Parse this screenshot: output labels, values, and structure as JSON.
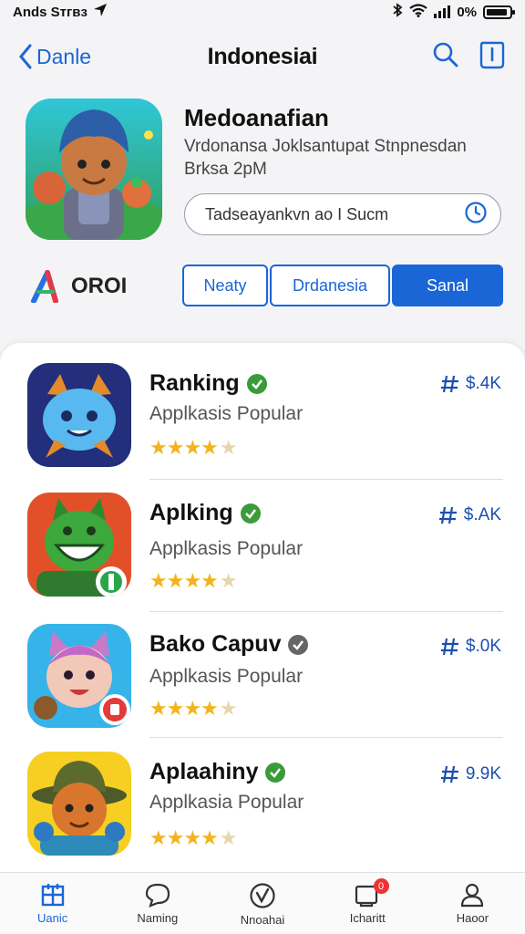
{
  "status_bar": {
    "carrier": "Ands Sтгвз",
    "battery": "0%",
    "battery_level": 0.9
  },
  "nav": {
    "back_label": "Danle",
    "title": "Indonesiai"
  },
  "header": {
    "app_name": "Medoanafian",
    "subtitle_line1": "Vrdonansa Joklsantupat Stnpnesdan",
    "subtitle_line2": "Brksa 2pM",
    "search_text": "Tadseayankvn ao I Sucm"
  },
  "brand": {
    "name": "OROI"
  },
  "segments": [
    {
      "label": "Neaty",
      "active": false
    },
    {
      "label": "Drdanesia",
      "active": false
    },
    {
      "label": "Sanal",
      "active": true
    }
  ],
  "apps": [
    {
      "title": "Ranking",
      "subtitle": "Applkasis Popular",
      "metric": "$.4K",
      "rating": 4.5,
      "check_color": "#3a9b3a"
    },
    {
      "title": "Aplking",
      "subtitle": "Applkasis Popular",
      "metric": "$.AK",
      "rating": 4.5,
      "check_color": "#3a9b3a"
    },
    {
      "title": "Bako Capuv",
      "subtitle": "Applkasis Popular",
      "metric": "$.0K",
      "rating": 4.5,
      "check_color": "#666666"
    },
    {
      "title": "Aplaahiny",
      "subtitle": "Applkasia Popular",
      "metric": "9.9K",
      "rating": 4.5,
      "check_color": "#3a9b3a"
    }
  ],
  "tabs": [
    {
      "label": "Uanic",
      "icon": "grid-icon",
      "active": true
    },
    {
      "label": "Naming",
      "icon": "chat-icon",
      "active": false
    },
    {
      "label": "Nnoahai",
      "icon": "check-circle-icon",
      "active": false
    },
    {
      "label": "Icharitt",
      "icon": "inbox-icon",
      "active": false,
      "badge": "0"
    },
    {
      "label": "Haoor",
      "icon": "profile-icon",
      "active": false
    }
  ],
  "colors": {
    "accent": "#1a66d6",
    "star": "#f2b41c",
    "background": "#f4f4f6"
  }
}
